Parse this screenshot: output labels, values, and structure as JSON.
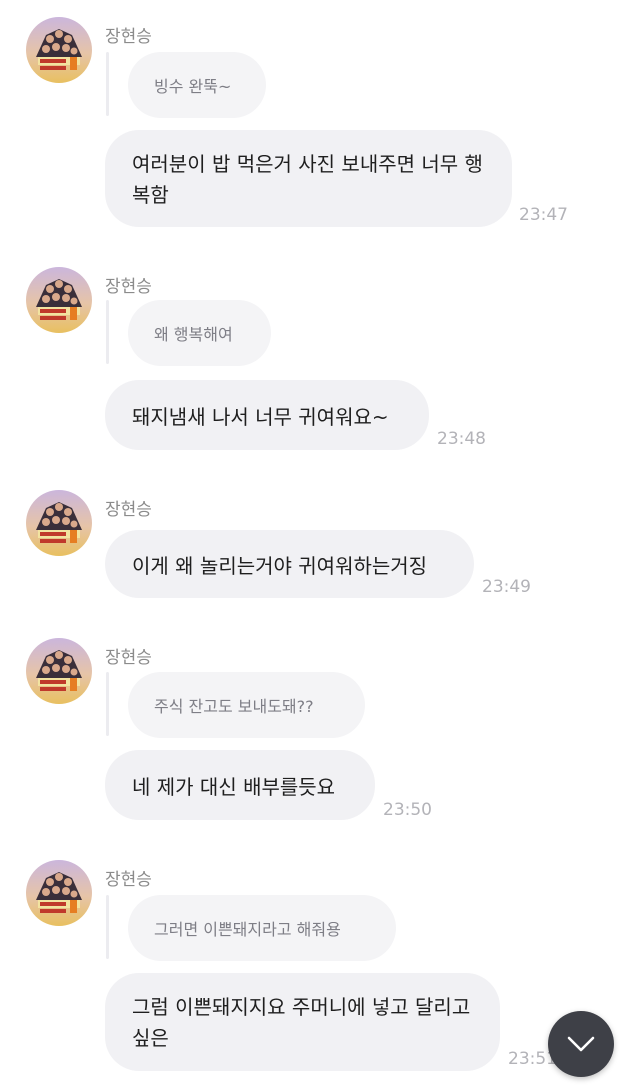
{
  "colors": {
    "bubble_bg": "#f1f1f4",
    "reply_bg": "#f4f4f6",
    "scroll_button_bg": "#3e4047",
    "timestamp": "#b3b3b8"
  },
  "icons": {
    "avatar": "profile-avatar-icon",
    "scroll": "chevron-down-icon"
  },
  "messages": [
    {
      "sender": "장현승",
      "reply": "빙수 완뚝~",
      "text": "여러분이 밥 먹은거 사진 보내주면 너무 행복함",
      "time": "23:47"
    },
    {
      "sender": "장현승",
      "reply": "왜 행복해여",
      "text": "돼지냄새 나서 너무 귀여워요~",
      "time": "23:48"
    },
    {
      "sender": "장현승",
      "text": "이게 왜 놀리는거야 귀여워하는거징",
      "time": "23:49"
    },
    {
      "sender": "장현승",
      "reply": "주식 잔고도 보내도돼??",
      "text": "네 제가 대신 배부를듯요",
      "time": "23:50"
    },
    {
      "sender": "장현승",
      "reply": "그러면 이쁜돼지라고 해줘용",
      "text": "그럼 이쁜돼지지요 주머니에 넣고 달리고싶은",
      "time": "23:51"
    }
  ]
}
